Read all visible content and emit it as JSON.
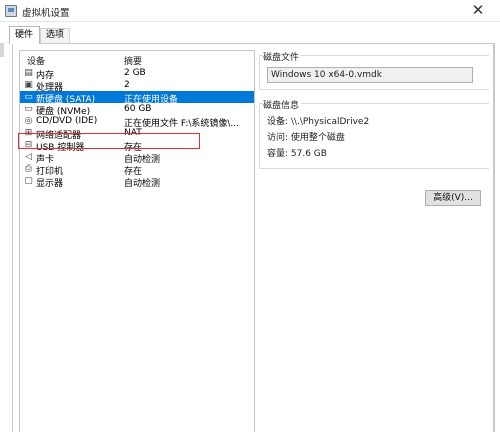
{
  "window": {
    "title": "虚拟机设置",
    "close_label": "✕"
  },
  "tabs": [
    {
      "label": "硬件"
    },
    {
      "label": "选项"
    }
  ],
  "devices": {
    "header_device": "设备",
    "header_summary": "摘要",
    "items": [
      {
        "icon": "memory-icon",
        "name": "内存",
        "summary": "2 GB"
      },
      {
        "icon": "processor-icon",
        "name": "处理器",
        "summary": "2"
      },
      {
        "icon": "hard-disk-icon",
        "name": "新硬盘 (SATA)",
        "summary": "正在使用设备"
      },
      {
        "icon": "hard-disk-icon",
        "name": "硬盘 (NVMe)",
        "summary": "60 GB"
      },
      {
        "icon": "cd-dvd-icon",
        "name": "CD/DVD (IDE)",
        "summary": "正在使用文件 F:\\系统镜像\\..."
      },
      {
        "icon": "network-adapter-icon",
        "name": "网络适配器",
        "summary": "NAT"
      },
      {
        "icon": "usb-icon",
        "name": "USB 控制器",
        "summary": "存在"
      },
      {
        "icon": "sound-card-icon",
        "name": "声卡",
        "summary": "自动检测"
      },
      {
        "icon": "printer-icon",
        "name": "打印机",
        "summary": "存在"
      },
      {
        "icon": "display-icon",
        "name": "显示器",
        "summary": "自动检测"
      }
    ],
    "selected_index": 2
  },
  "disk_file": {
    "title": "磁盘文件",
    "value": "Windows 10 x64-0.vmdk"
  },
  "disk_info": {
    "title": "磁盘信息",
    "device_line": "设备: \\\\.\\PhysicalDrive2",
    "access_line": "访问: 使用整个磁盘",
    "capacity_line": "容量: 57.6 GB"
  },
  "advanced_button": "高级(V)...",
  "colors": {
    "selection": "#0078d7",
    "highlight_box": "#e03030"
  }
}
